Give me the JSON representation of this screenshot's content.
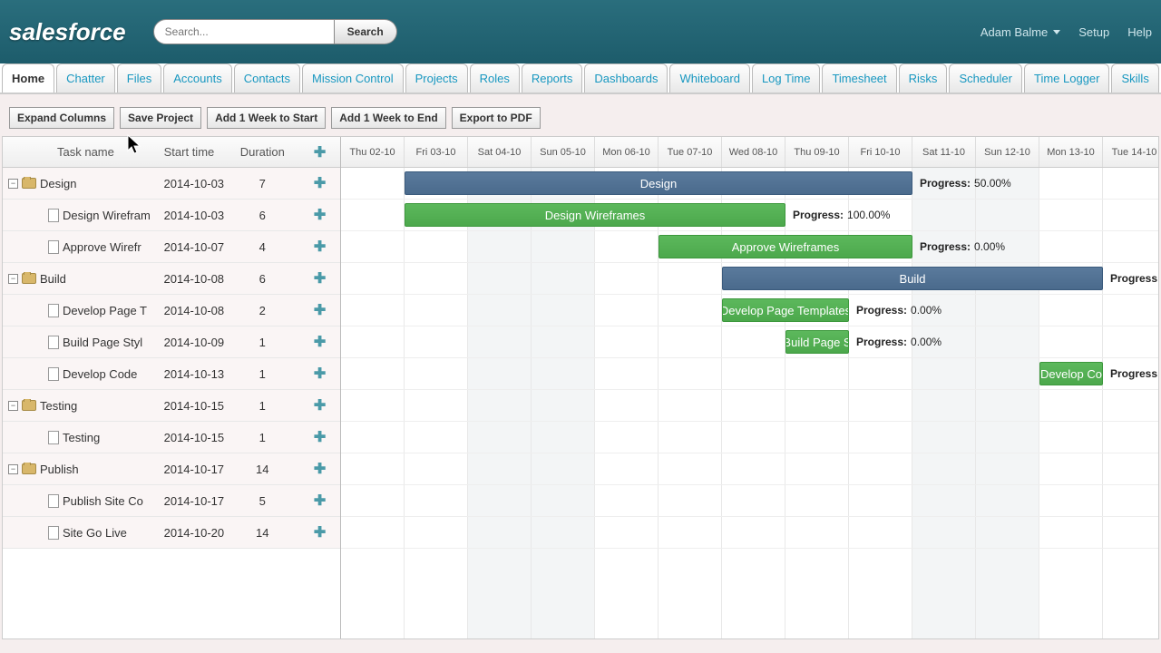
{
  "header": {
    "logo_text": "salesforce",
    "search_placeholder": "Search...",
    "search_button": "Search",
    "user_name": "Adam Balme",
    "setup": "Setup",
    "help": "Help"
  },
  "nav": {
    "tabs": [
      "Home",
      "Chatter",
      "Files",
      "Accounts",
      "Contacts",
      "Mission Control",
      "Projects",
      "Roles",
      "Reports",
      "Dashboards",
      "Whiteboard",
      "Log Time",
      "Timesheet",
      "Risks",
      "Scheduler",
      "Time Logger",
      "Skills"
    ],
    "active_index": 0
  },
  "toolbar": {
    "buttons": [
      "Expand Columns",
      "Save Project",
      "Add 1 Week to Start",
      "Add 1 Week to End",
      "Export to PDF"
    ]
  },
  "columns": {
    "task": "Task name",
    "start": "Start time",
    "duration": "Duration"
  },
  "dates": [
    "Thu 02-10",
    "Fri 03-10",
    "Sat 04-10",
    "Sun 05-10",
    "Mon 06-10",
    "Tue 07-10",
    "Wed 08-10",
    "Thu 09-10",
    "Fri 10-10",
    "Sat 11-10",
    "Sun 12-10",
    "Mon 13-10",
    "Tue 14-10"
  ],
  "weekend_cols": [
    2,
    3,
    9,
    10
  ],
  "tasks": [
    {
      "name": "Design",
      "start": "2014-10-03",
      "duration": "7",
      "group": true
    },
    {
      "name": "Design Wirefram",
      "start": "2014-10-03",
      "duration": "6",
      "group": false
    },
    {
      "name": "Approve Wirefr",
      "start": "2014-10-07",
      "duration": "4",
      "group": false
    },
    {
      "name": "Build",
      "start": "2014-10-08",
      "duration": "6",
      "group": true
    },
    {
      "name": "Develop Page T",
      "start": "2014-10-08",
      "duration": "2",
      "group": false
    },
    {
      "name": "Build Page Styl",
      "start": "2014-10-09",
      "duration": "1",
      "group": false
    },
    {
      "name": "Develop Code",
      "start": "2014-10-13",
      "duration": "1",
      "group": false
    },
    {
      "name": "Testing",
      "start": "2014-10-15",
      "duration": "1",
      "group": true
    },
    {
      "name": "Testing",
      "start": "2014-10-15",
      "duration": "1",
      "group": false
    },
    {
      "name": "Publish",
      "start": "2014-10-17",
      "duration": "14",
      "group": true
    },
    {
      "name": "Publish Site Co",
      "start": "2014-10-17",
      "duration": "5",
      "group": false
    },
    {
      "name": "Site Go Live",
      "start": "2014-10-20",
      "duration": "14",
      "group": false
    }
  ],
  "bars": [
    {
      "row": 0,
      "col": 1,
      "span": 8,
      "type": "group",
      "label": "Design",
      "progress": "50.00%"
    },
    {
      "row": 1,
      "col": 1,
      "span": 6,
      "type": "task",
      "label": "Design Wireframes",
      "progress": "100.00%"
    },
    {
      "row": 2,
      "col": 5,
      "span": 4,
      "type": "task",
      "label": "Approve Wireframes",
      "progress": "0.00%"
    },
    {
      "row": 3,
      "col": 6,
      "span": 6,
      "type": "group",
      "label": "Build",
      "progress": ""
    },
    {
      "row": 4,
      "col": 6,
      "span": 2,
      "type": "task",
      "label": "Develop Page Templates",
      "progress": "0.00%"
    },
    {
      "row": 5,
      "col": 7,
      "span": 1,
      "type": "task",
      "label": "Build Page S",
      "progress": "0.00%"
    },
    {
      "row": 6,
      "col": 11,
      "span": 1,
      "type": "task",
      "label": "Develop Co",
      "progress": ""
    }
  ],
  "progress_prefix": "Progress:",
  "right_edge_progress": [
    {
      "row": 3,
      "text": "Progress:"
    },
    {
      "row": 6,
      "text": "Progress:"
    }
  ]
}
